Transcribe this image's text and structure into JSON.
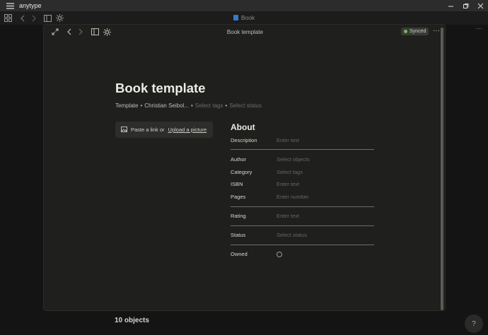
{
  "titlebar": {
    "app_name": "anytype"
  },
  "apptoolbar": {
    "document_title": "Book"
  },
  "page": {
    "panel_title": "Book template",
    "sync_status": "Synced",
    "heading": "Book template",
    "meta": {
      "type": "Template",
      "author": "Christian Seibol...",
      "tags_placeholder": "Select tags",
      "status_placeholder": "Select status"
    },
    "upload": {
      "prefix": "Paste a link or",
      "link": "Upload a picture"
    }
  },
  "about": {
    "title": "About",
    "relations": [
      {
        "label": "Description",
        "placeholder": "Enter text"
      },
      {
        "label": "Author",
        "placeholder": "Select objects"
      },
      {
        "label": "Category",
        "placeholder": "Select tags"
      },
      {
        "label": "ISBN",
        "placeholder": "Enter text"
      },
      {
        "label": "Pages",
        "placeholder": "Enter number"
      },
      {
        "label": "Rating",
        "placeholder": "Enter text"
      },
      {
        "label": "Status",
        "placeholder": "Select status"
      },
      {
        "label": "Owned",
        "placeholder": ""
      }
    ]
  },
  "footer": {
    "objects_count": "10 objects",
    "help_label": "?"
  },
  "icons": [
    "hamburger-icon",
    "minimize-icon",
    "maximize-icon",
    "close-icon",
    "grid-icon",
    "back-arrow-icon",
    "forward-arrow-icon",
    "sidebar-icon",
    "graph-icon",
    "expand-icon",
    "image-icon",
    "more-icon"
  ],
  "colors": {
    "synced_dot": "#6cc04a",
    "book_icon": "#3a78c9",
    "background": "#1f1f1d"
  }
}
